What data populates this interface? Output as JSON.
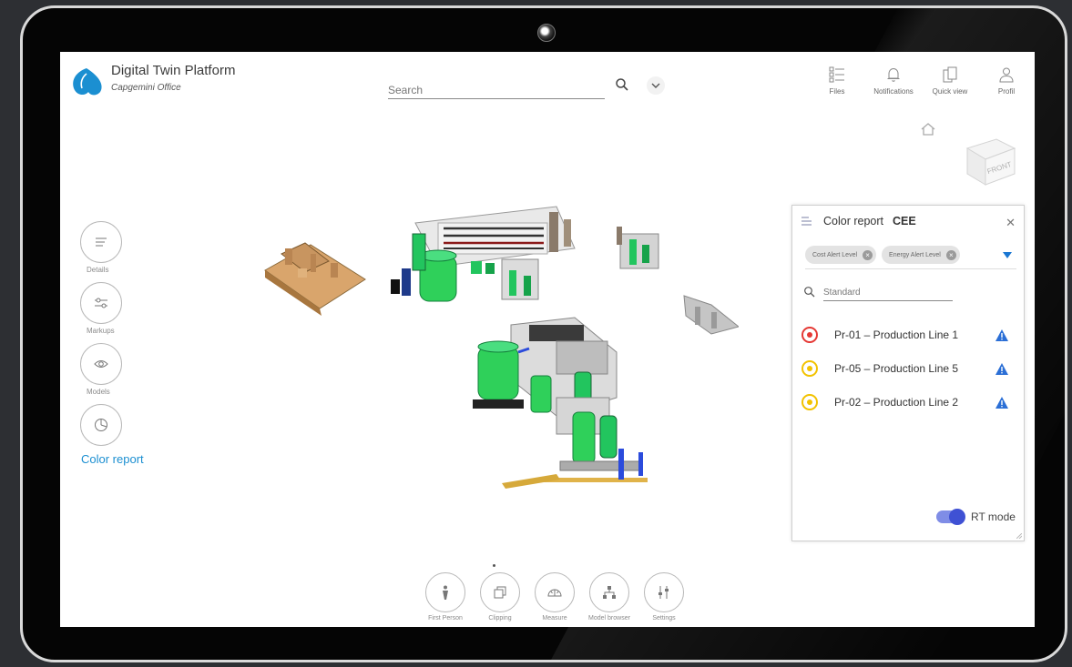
{
  "app": {
    "title": "Digital Twin Platform",
    "subtitle": "Capgemini Office"
  },
  "search": {
    "placeholder": "Search"
  },
  "toolbar": [
    {
      "label": "Files",
      "icon": "files-icon"
    },
    {
      "label": "Notifications",
      "icon": "bell-icon"
    },
    {
      "label": "Quick view",
      "icon": "quick-view-icon"
    },
    {
      "label": "Profil",
      "icon": "profile-icon"
    }
  ],
  "viewcube": {
    "face": "FRONT"
  },
  "side_menu": [
    {
      "label": "Details",
      "icon": "details-icon"
    },
    {
      "label": "Markups",
      "icon": "markups-icon"
    },
    {
      "label": "Models",
      "icon": "models-icon"
    },
    {
      "label": "Color report",
      "icon": "pie-chart-icon",
      "active": true
    }
  ],
  "panel": {
    "title": "Color report",
    "site": "CEE",
    "chips": [
      "Cost Alert Level",
      "Energy Alert Level"
    ],
    "search_placeholder": "Standard",
    "rows": [
      {
        "label": "Pr-01 – Production Line 1",
        "status": "critical",
        "color": "#e53935"
      },
      {
        "label": "Pr-05 – Production Line 5",
        "status": "warning",
        "color": "#f2c200"
      },
      {
        "label": "Pr-02 – Production Line 2",
        "status": "warning",
        "color": "#f2c200"
      }
    ],
    "rt_mode": {
      "label": "RT mode",
      "on": true
    }
  },
  "bottom_toolbar": [
    {
      "label": "First Person",
      "icon": "person-icon"
    },
    {
      "label": "Clipping",
      "icon": "clipping-icon"
    },
    {
      "label": "Measure",
      "icon": "measure-icon"
    },
    {
      "label": "Model browser",
      "icon": "hierarchy-icon"
    },
    {
      "label": "Settings",
      "icon": "settings-icon"
    }
  ],
  "colors": {
    "accent": "#1b8fd1",
    "toggle": "#3f51d4",
    "warning": "#2b6fd6",
    "model_green": "#22c55e"
  }
}
